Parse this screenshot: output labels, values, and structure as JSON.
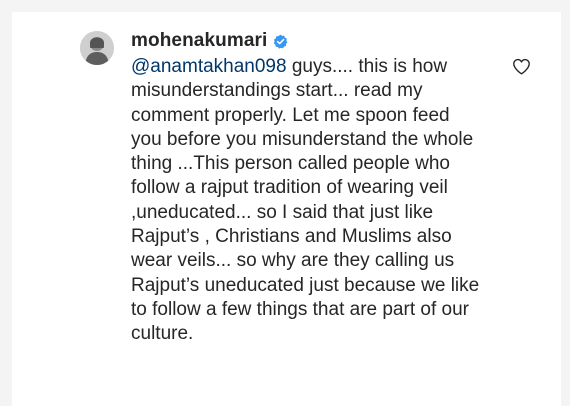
{
  "comment": {
    "username": "mohenakumari",
    "mention": "@anamtakhan098",
    "text": " guys.... this is how misunderstandings start... read my comment properly. Let me spoon feed you before you misunderstand the whole thing ...This person called people who follow a rajput tradition of wearing veil ,uneducated... so I said that just like Rajput’s , Christians and Muslims also wear veils... so why are they calling us Rajput’s uneducated just because we like to follow a few things that are part of our culture."
  },
  "colors": {
    "verified": "#3897f0",
    "mention": "#00376b",
    "text": "#262626",
    "background": "#f3f4f3"
  },
  "icons": {
    "avatar": "profile-photo",
    "verified": "verified-badge-icon",
    "like": "heart-outline-icon"
  }
}
